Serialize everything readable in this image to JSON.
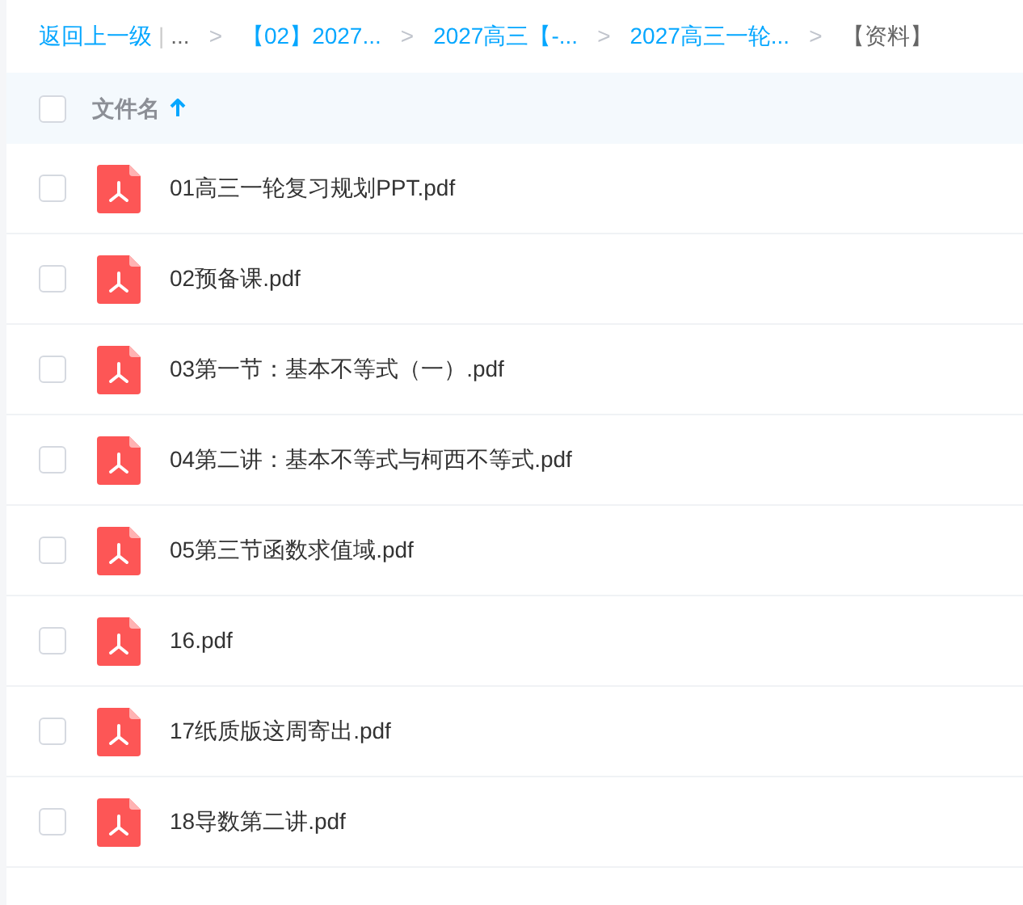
{
  "breadcrumb": [
    {
      "kind": "back",
      "text": "返回上一级"
    },
    {
      "kind": "divider",
      "text": "|"
    },
    {
      "kind": "ellipsis",
      "text": "..."
    },
    {
      "kind": "separator",
      "text": ">"
    },
    {
      "kind": "link",
      "text": "【02】2027..."
    },
    {
      "kind": "separator",
      "text": ">"
    },
    {
      "kind": "link",
      "text": "2027高三【-..."
    },
    {
      "kind": "separator",
      "text": ">"
    },
    {
      "kind": "link",
      "text": "2027高三一轮..."
    },
    {
      "kind": "separator",
      "text": ">"
    },
    {
      "kind": "current",
      "text": "【资料】"
    }
  ],
  "header": {
    "checked": false,
    "column": "文件名",
    "sort_ascending": true
  },
  "files": [
    {
      "name": "01高三一轮复习规划PPT.pdf",
      "checked": false
    },
    {
      "name": "02预备课.pdf",
      "checked": false
    },
    {
      "name": "03第一节：基本不等式（一）.pdf",
      "checked": false
    },
    {
      "name": "04第二讲：基本不等式与柯西不等式.pdf",
      "checked": false
    },
    {
      "name": "05第三节函数求值域.pdf",
      "checked": false
    },
    {
      "name": "16.pdf",
      "checked": false
    },
    {
      "name": "17纸质版这周寄出.pdf",
      "checked": false
    },
    {
      "name": "18导数第二讲.pdf",
      "checked": false
    }
  ]
}
